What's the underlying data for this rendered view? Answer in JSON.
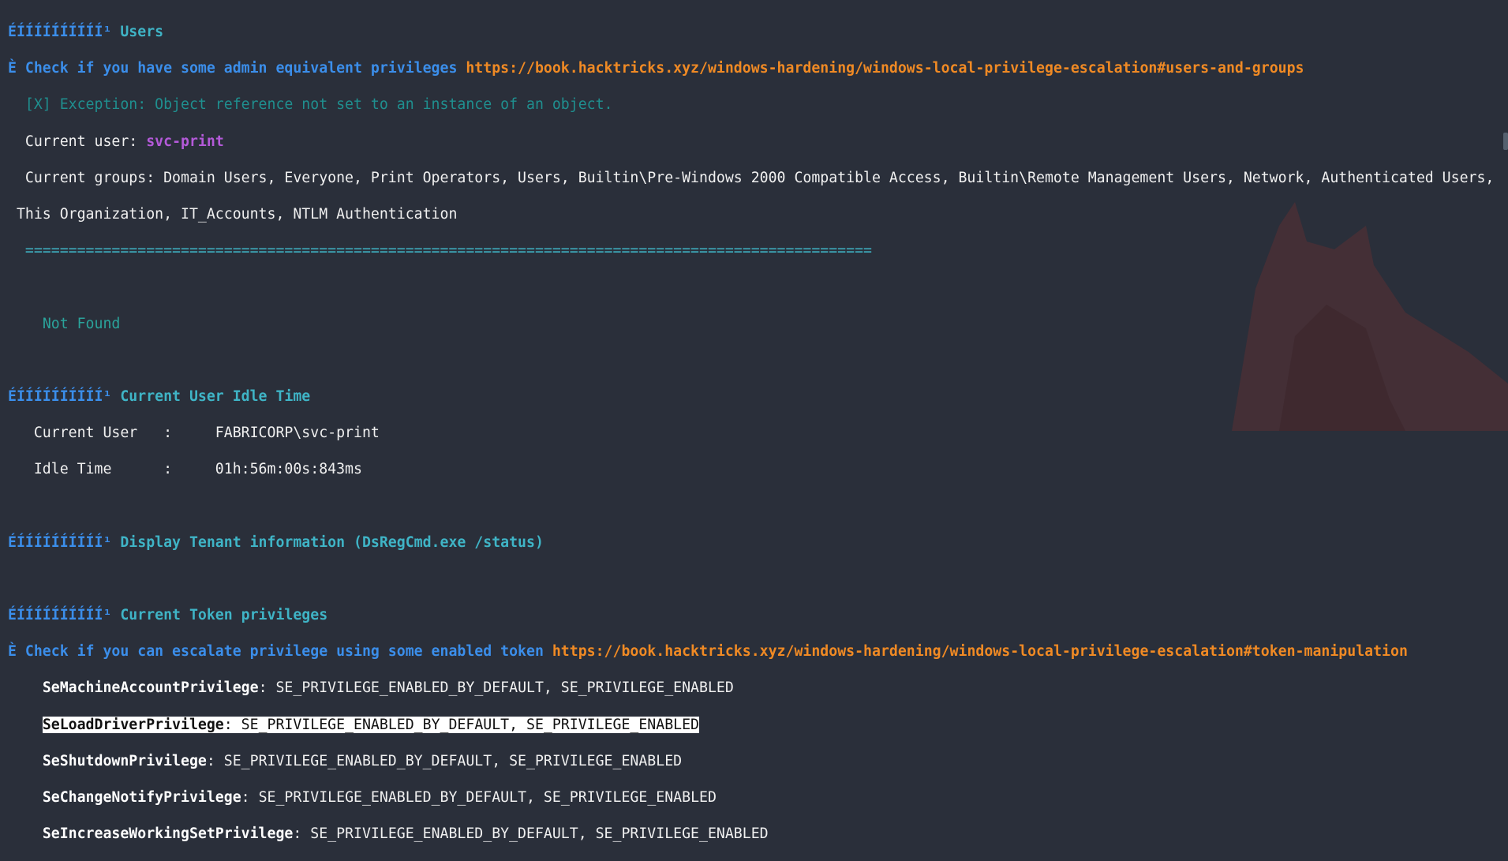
{
  "sections": {
    "users": {
      "marker": "ÉÍÍÍÍÍÍÍÍÍÍ¹",
      "title": "Users",
      "check_prefix": "È",
      "check_text": "Check if you have some admin equivalent privileges",
      "check_url": "https://book.hacktricks.xyz/windows-hardening/windows-local-privilege-escalation#users-and-groups",
      "exception": "[X] Exception: Object reference not set to an instance of an object.",
      "current_user_label": "Current user:",
      "current_user_value": "svc-print",
      "groups_line1": "Current groups: Domain Users, Everyone, Print Operators, Users, Builtin\\Pre-Windows 2000 Compatible Access, Builtin\\Remote Management Users, Network, Authenticated Users,",
      "groups_line2": "This Organization, IT_Accounts, NTLM Authentication",
      "separator": "==================================================================================================",
      "not_found": "Not Found"
    },
    "idle": {
      "marker": "ÉÍÍÍÍÍÍÍÍÍÍ¹",
      "title": "Current User Idle Time",
      "user_line": "Current User   :     FABRICORP\\svc-print",
      "idle_line": "Idle Time      :     01h:56m:00s:843ms"
    },
    "tenant": {
      "marker": "ÉÍÍÍÍÍÍÍÍÍÍ¹",
      "title": "Display Tenant information (DsRegCmd.exe /status)"
    },
    "tokens": {
      "marker": "ÉÍÍÍÍÍÍÍÍÍÍ¹",
      "title": "Current Token privileges",
      "check_prefix": "È",
      "check_text": "Check if you can escalate privilege using some enabled token",
      "check_url": "https://book.hacktricks.xyz/windows-hardening/windows-local-privilege-escalation#token-manipulation",
      "privileges": [
        {
          "name": "SeMachineAccountPrivilege",
          "value": "SE_PRIVILEGE_ENABLED_BY_DEFAULT, SE_PRIVILEGE_ENABLED"
        },
        {
          "name": "SeLoadDriverPrivilege",
          "value": "SE_PRIVILEGE_ENABLED_BY_DEFAULT, SE_PRIVILEGE_ENABLED"
        },
        {
          "name": "SeShutdownPrivilege",
          "value": "SE_PRIVILEGE_ENABLED_BY_DEFAULT, SE_PRIVILEGE_ENABLED"
        },
        {
          "name": "SeChangeNotifyPrivilege",
          "value": "SE_PRIVILEGE_ENABLED_BY_DEFAULT, SE_PRIVILEGE_ENABLED"
        },
        {
          "name": "SeIncreaseWorkingSetPrivilege",
          "value": "SE_PRIVILEGE_ENABLED_BY_DEFAULT, SE_PRIVILEGE_ENABLED"
        }
      ]
    }
  },
  "colors": {
    "background": "#2a2f3a",
    "header_blue": "#3b8eea",
    "title_cyan": "#3fb4c6",
    "url_orange": "#f08a24",
    "user_purple": "#b45ad9"
  }
}
